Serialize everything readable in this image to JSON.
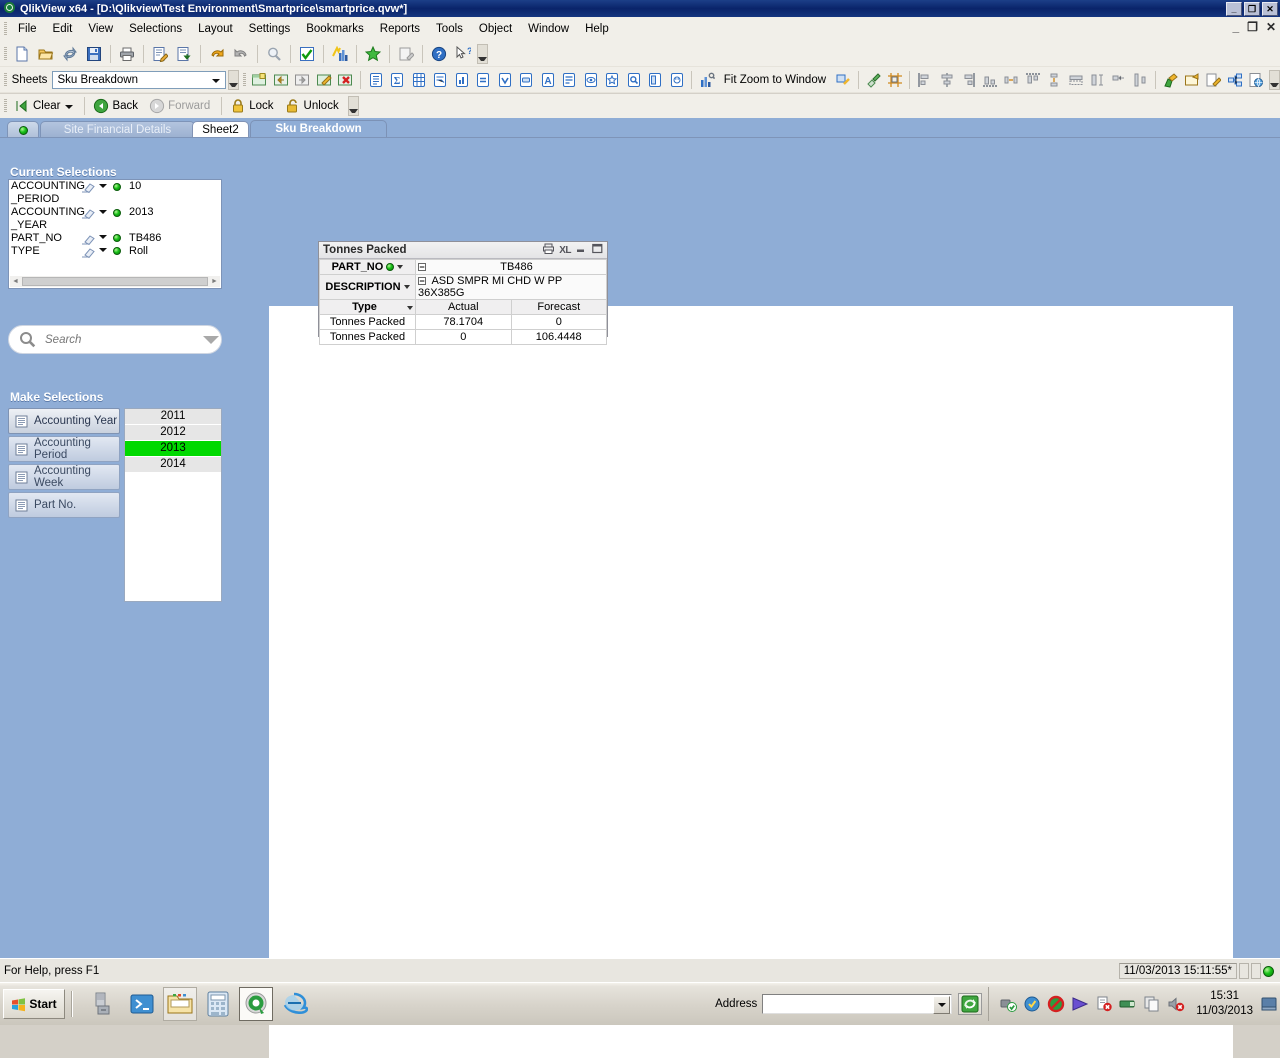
{
  "window": {
    "title": "QlikView x64 - [D:\\Qlikview\\Test Environment\\Smartprice\\smartprice.qvw*]",
    "app_icon": "qlikview-logo-icon",
    "minimize": "_",
    "maximize": "❐",
    "close": "✕",
    "doc_minimize": "_",
    "doc_restore": "❐",
    "doc_close": "✕"
  },
  "menu": {
    "items": [
      {
        "label": "File",
        "name": "menu-file"
      },
      {
        "label": "Edit",
        "name": "menu-edit"
      },
      {
        "label": "View",
        "name": "menu-view"
      },
      {
        "label": "Selections",
        "name": "menu-selections"
      },
      {
        "label": "Layout",
        "name": "menu-layout"
      },
      {
        "label": "Settings",
        "name": "menu-settings"
      },
      {
        "label": "Bookmarks",
        "name": "menu-bookmarks"
      },
      {
        "label": "Reports",
        "name": "menu-reports"
      },
      {
        "label": "Tools",
        "name": "menu-tools"
      },
      {
        "label": "Object",
        "name": "menu-object"
      },
      {
        "label": "Window",
        "name": "menu-window"
      },
      {
        "label": "Help",
        "name": "menu-help"
      }
    ]
  },
  "toolbar_standard": {
    "icons": [
      "new-document-icon",
      "open-document-icon",
      "reload-icon",
      "save-icon",
      "print-icon",
      "edit-script-icon",
      "export-icon",
      "undo-icon",
      "redo-icon",
      "search-icon",
      "select-possible-icon",
      "chart-wizard-icon",
      "bookmark-star-icon",
      "note-icon",
      "help-icon",
      "context-help-icon"
    ],
    "overflow": "toolbar-overflow"
  },
  "toolbar_sheet": {
    "sheets_label": "Sheets",
    "current_sheet": "Sku Breakdown",
    "sheet_options": [
      "Site Financial Details",
      "Sheet2",
      "Sku Breakdown"
    ],
    "icons": [
      "add-sheet-icon",
      "promote-sheet-icon",
      "demote-sheet-icon",
      "sheet-properties-icon",
      "remove-sheet-icon",
      "list-box-icon",
      "statistics-box-icon",
      "table-box-icon",
      "multi-box-icon",
      "bar-chart-icon",
      "expression-icon",
      "check-box-icon",
      "button-icon",
      "text-object-icon",
      "input-box-icon",
      "current-selections-icon",
      "bookmark-object-icon",
      "search-object-icon",
      "container-icon",
      "slider-icon",
      "chart-properties-icon"
    ],
    "fit_zoom_label": "Fit Zoom to Window",
    "right_icons": [
      "zoom-icon",
      "format-painter-icon",
      "snap-to-grid-icon",
      "align-left-icon",
      "align-center-icon",
      "align-right-icon",
      "align-bottom-icon",
      "distribute-h-icon",
      "align-top-icon",
      "distribute-v-icon",
      "same-width-icon",
      "same-height-icon",
      "space-equal-icon",
      "design-grid-icon",
      "themes-icon",
      "new-object-icon",
      "edit-module-icon",
      "link-objects-icon",
      "web-view-icon"
    ]
  },
  "toolbar_navigation": {
    "clear_label": "Clear",
    "back_label": "Back",
    "forward_label": "Forward",
    "lock_label": "Lock",
    "unlock_label": "Unlock"
  },
  "sheet_tabs": {
    "status_dot": "green-status-dot",
    "tabs": [
      {
        "label": "Site Financial Details",
        "state": "inactive"
      },
      {
        "label": "Sheet2",
        "state": "white"
      },
      {
        "label": "Sku Breakdown",
        "state": "active"
      }
    ]
  },
  "current_selections": {
    "title": "Current Selections",
    "rows": [
      {
        "field_line1": "ACCOUNTING",
        "field_line2": "_PERIOD",
        "value": "10",
        "state": "green-selected"
      },
      {
        "field_line1": "ACCOUNTING",
        "field_line2": "_YEAR",
        "value": "2013",
        "state": "green-selected"
      },
      {
        "field_line1": "PART_NO",
        "field_line2": "",
        "value": "TB486",
        "state": "green-selected"
      },
      {
        "field_line1": "TYPE",
        "field_line2": "",
        "value": "Roll",
        "state": "green-selected"
      }
    ]
  },
  "search": {
    "placeholder": "Search",
    "value": "",
    "icon": "search-magnifier-icon",
    "dropdown_icon": "chevron-down-icon"
  },
  "make_selections": {
    "title": "Make Selections",
    "buttons": [
      {
        "label": "Accounting Year",
        "selected": true
      },
      {
        "label": "Accounting Period",
        "selected": false
      },
      {
        "label": "Accounting Week",
        "selected": false
      },
      {
        "label": "Part No.",
        "selected": false
      }
    ],
    "year_list": [
      {
        "value": "2011",
        "selected": false
      },
      {
        "value": "2012",
        "selected": false
      },
      {
        "value": "2013",
        "selected": true
      },
      {
        "value": "2014",
        "selected": false
      }
    ]
  },
  "pivot_object": {
    "caption": "Tonnes Packed",
    "caption_icons": [
      "print-object-icon",
      "XL",
      "minimize-object-icon",
      "maximize-object-icon"
    ],
    "xl_label": "XL",
    "row_part_no_label": "PART_NO",
    "row_part_no_value": "TB486",
    "row_description_label": "DESCRIPTION",
    "row_description_value": "ASD SMPR MI CHD W PP 36X385G",
    "row_type_label": "Type",
    "col_headers": [
      "Actual",
      "Forecast"
    ],
    "rows": [
      {
        "label": "Tonnes Packed",
        "actual": "78.1704",
        "forecast": "0"
      },
      {
        "label": "Tonnes Packed",
        "actual": "0",
        "forecast": "106.4448"
      }
    ]
  },
  "status_bar": {
    "help_text": "For Help, press F1",
    "timestamp": "11/03/2013 15:11:55*",
    "status_dot": "green-status-dot"
  },
  "taskbar": {
    "start_label": "Start",
    "quicklaunch": [
      "server-manager-icon",
      "powershell-icon",
      "file-explorer-icon",
      "calculator-icon",
      "qlikview-icon",
      "internet-explorer-icon"
    ],
    "address_label": "Address",
    "address_value": "",
    "go_icon": "go-refresh-icon",
    "tray_icons": [
      "network-ok-icon",
      "update-icon",
      "security-alert-icon",
      "media-player-icon",
      "document-error-icon",
      "network-card-icon",
      "copy-icon",
      "volume-muted-icon"
    ],
    "clock_time": "15:31",
    "clock_date": "11/03/2013",
    "show_desktop": "show-desktop-icon"
  },
  "colors": {
    "title_blue": "#0a246a",
    "workspace_blue": "#8fadd6",
    "selection_green": "#00d900",
    "toolbar_bg": "#f1efe9"
  }
}
